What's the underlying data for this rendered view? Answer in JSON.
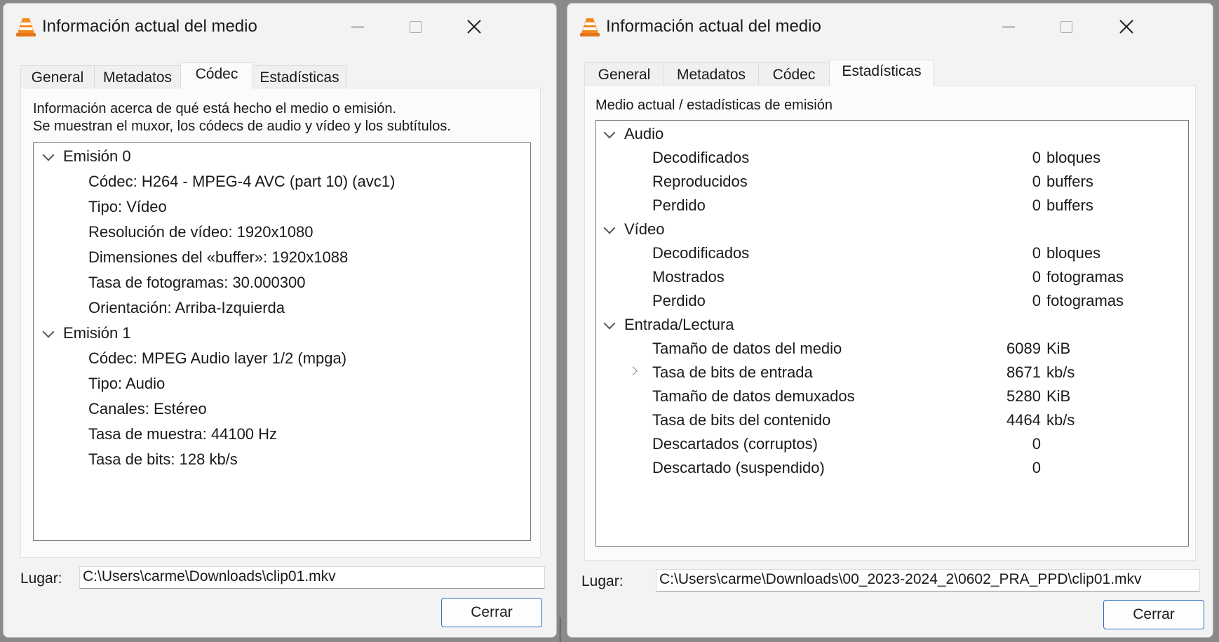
{
  "window_a": {
    "title": "Información actual del medio",
    "tabs": [
      "General",
      "Metadatos",
      "Códec",
      "Estadísticas"
    ],
    "active_tab": "Códec",
    "description_line1": "Información acerca de qué está hecho el medio o emisión.",
    "description_line2": "Se muestran el muxor, los códecs de audio y vídeo y los subtítulos.",
    "tree": [
      {
        "label": "Emisión 0",
        "children": [
          "Códec: H264 - MPEG-4 AVC (part 10) (avc1)",
          "Tipo: Vídeo",
          "Resolución de vídeo: 1920x1080",
          "Dimensiones del «buffer»: 1920x1088",
          "Tasa de fotogramas: 30.000300",
          "Orientación: Arriba-Izquierda"
        ]
      },
      {
        "label": "Emisión 1",
        "children": [
          "Códec: MPEG Audio layer 1/2 (mpga)",
          "Tipo: Audio",
          "Canales: Estéreo",
          "Tasa de muestra: 44100 Hz",
          "Tasa de bits: 128 kb/s"
        ]
      }
    ],
    "location_label": "Lugar:",
    "location_value": "C:\\Users\\carme\\Downloads\\clip01.mkv",
    "close_label": "Cerrar"
  },
  "window_b": {
    "title": "Información actual del medio",
    "tabs": [
      "General",
      "Metadatos",
      "Códec",
      "Estadísticas"
    ],
    "active_tab": "Estadísticas",
    "heading": "Medio actual / estadísticas de emisión",
    "groups": [
      {
        "label": "Audio",
        "rows": [
          {
            "name": "Decodificados",
            "value": "0",
            "unit": "bloques"
          },
          {
            "name": "Reproducidos",
            "value": "0",
            "unit": "buffers"
          },
          {
            "name": "Perdido",
            "value": "0",
            "unit": "buffers"
          }
        ]
      },
      {
        "label": "Vídeo",
        "rows": [
          {
            "name": "Decodificados",
            "value": "0",
            "unit": "bloques"
          },
          {
            "name": "Mostrados",
            "value": "0",
            "unit": "fotogramas"
          },
          {
            "name": "Perdido",
            "value": "0",
            "unit": "fotogramas"
          }
        ]
      },
      {
        "label": "Entrada/Lectura",
        "rows": [
          {
            "name": "Tamaño de datos del medio",
            "value": "6089",
            "unit": "KiB"
          },
          {
            "name": "Tasa de bits de entrada",
            "value": "8671",
            "unit": "kb/s",
            "expandable": true
          },
          {
            "name": "Tamaño de datos demuxados",
            "value": "5280",
            "unit": "KiB"
          },
          {
            "name": "Tasa de bits del contenido",
            "value": "4464",
            "unit": "kb/s"
          },
          {
            "name": "Descartados (corruptos)",
            "value": "0",
            "unit": ""
          },
          {
            "name": "Descartado (suspendido)",
            "value": "0",
            "unit": ""
          }
        ]
      }
    ],
    "location_label": "Lugar:",
    "location_value": "C:\\Users\\carme\\Downloads\\00_2023-2024_2\\0602_PRA_PPD\\clip01.mkv",
    "close_label": "Cerrar"
  },
  "colors": {
    "button_border": "#2e6fc4",
    "window_bg": "#f3f3f3",
    "tree_border": "#7a7a7a"
  }
}
